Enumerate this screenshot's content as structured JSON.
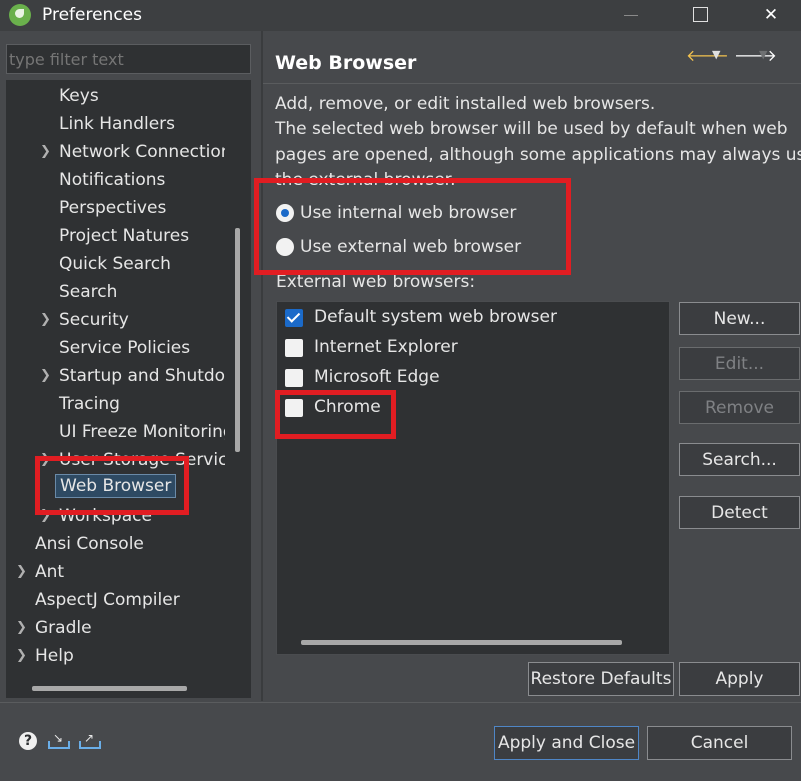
{
  "window": {
    "title": "Preferences"
  },
  "filter": {
    "placeholder": "type filter text"
  },
  "tree": {
    "items": [
      {
        "label": "Keys"
      },
      {
        "label": "Link Handlers"
      },
      {
        "label": "Network Connections"
      },
      {
        "label": "Notifications"
      },
      {
        "label": "Perspectives"
      },
      {
        "label": "Project Natures"
      },
      {
        "label": "Quick Search"
      },
      {
        "label": "Search"
      },
      {
        "label": "Security"
      },
      {
        "label": "Service Policies"
      },
      {
        "label": "Startup and Shutdown"
      },
      {
        "label": "Tracing"
      },
      {
        "label": "UI Freeze Monitoring"
      },
      {
        "label": "User Storage Service"
      },
      {
        "label": "Web Browser",
        "selected": true
      },
      {
        "label": "Workspace"
      },
      {
        "label": "Ansi Console"
      },
      {
        "label": "Ant"
      },
      {
        "label": "AspectJ Compiler"
      },
      {
        "label": "Gradle"
      },
      {
        "label": "Help"
      }
    ]
  },
  "page": {
    "title": "Web Browser",
    "description": [
      "Add, remove, or edit installed web browsers.",
      "The selected web browser will be used by default when web",
      "pages are opened, although some applications may always use",
      "the external browser."
    ],
    "radio_internal": "Use internal web browser",
    "radio_external": "Use external web browser",
    "selected_mode": "internal",
    "external_label": "External web browsers:",
    "browsers": [
      {
        "label": "Default system web browser",
        "checked": true
      },
      {
        "label": "Internet Explorer",
        "checked": false
      },
      {
        "label": "Microsoft Edge",
        "checked": false
      },
      {
        "label": "Chrome",
        "checked": false
      }
    ],
    "buttons": {
      "new": "New...",
      "edit": "Edit...",
      "remove": "Remove",
      "search": "Search...",
      "detect": "Detect",
      "restore_defaults": "Restore Defaults",
      "apply": "Apply"
    }
  },
  "footer": {
    "apply_and_close": "Apply and Close",
    "cancel": "Cancel"
  },
  "colors": {
    "highlight": "#e11d22",
    "accent": "#1b6ac9"
  }
}
